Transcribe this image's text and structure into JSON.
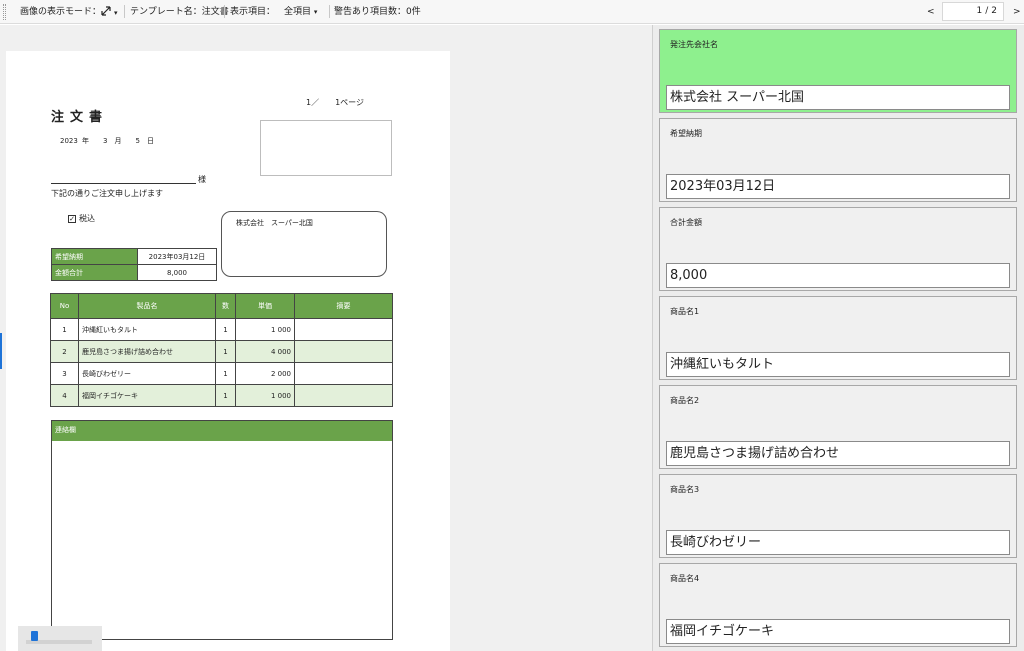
{
  "toolbar": {
    "display_mode_label": "画像の表示モード：",
    "fit_icon": "diagonal-arrows-icon",
    "dropdown_arrow": "▾",
    "template_label": "テンプレート名：注文書",
    "display_items_label": "表示項目：",
    "display_items_value": "全項目",
    "warnings_label": "警告あり項目数：0件",
    "prev": "<",
    "next": ">",
    "page_current": "1",
    "page_sep": "/",
    "page_total": "2"
  },
  "document": {
    "title": "注文書",
    "page_indicator": "1／　　1ページ",
    "date": "2023 年　　3　月　　5　日",
    "sama": "様",
    "greeting": "下記の通りご注文申し上げます",
    "tax_check": "☑",
    "tax_label": "税込",
    "vendor_name": "株式会社　スーパー北国",
    "info": [
      {
        "key": "希望納期",
        "value": "2023年03月12日"
      },
      {
        "key": "金額合計",
        "value": "8,000"
      }
    ],
    "items_headers": [
      "No",
      "製品名",
      "数",
      "単価",
      "摘要"
    ],
    "items": [
      {
        "no": "1",
        "name": "沖縄紅いもタルト",
        "qty": "1",
        "price": "1 000",
        "note": ""
      },
      {
        "no": "2",
        "name": "鹿児島さつま揚げ詰め合わせ",
        "qty": "1",
        "price": "4 000",
        "note": ""
      },
      {
        "no": "3",
        "name": "長崎びわゼリー",
        "qty": "1",
        "price": "2 000",
        "note": ""
      },
      {
        "no": "4",
        "name": "福岡イチゴケーキ",
        "qty": "1",
        "price": "1 000",
        "note": ""
      }
    ],
    "notes_label": "連絡欄"
  },
  "zoom": {
    "level": 0.1
  },
  "fields": [
    {
      "label": "発注先会社名",
      "value": "株式会社 スーパー北国"
    },
    {
      "label": "希望納期",
      "value": "2023年03月12日"
    },
    {
      "label": "合計金額",
      "value": "8,000"
    },
    {
      "label": "商品名1",
      "value": "沖縄紅いもタルト"
    },
    {
      "label": "商品名2",
      "value": "鹿児島さつま揚げ詰め合わせ"
    },
    {
      "label": "商品名3",
      "value": "長崎びわゼリー"
    },
    {
      "label": "商品名4",
      "value": "福岡イチゴケーキ"
    }
  ],
  "colors": {
    "accent_green": "#6aa34a",
    "highlight_green": "#8ef08e",
    "accent_blue": "#1e73d8"
  }
}
